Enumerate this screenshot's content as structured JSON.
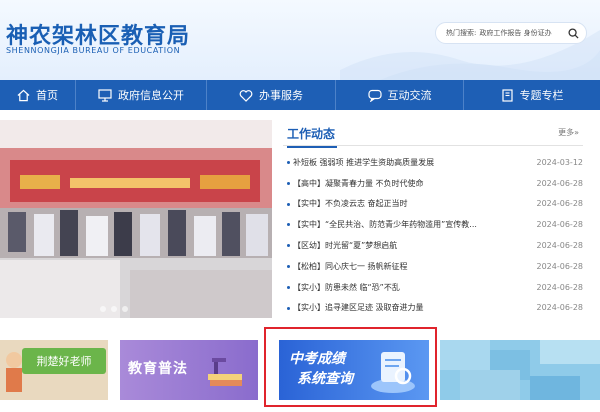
{
  "header": {
    "title_cn": "神农架林区教育局",
    "title_en": "SHENNONGJIA BUREAU OF EDUCATION",
    "search": {
      "label": "热门搜索:",
      "hot_terms": "政府工作报告 身份证办"
    }
  },
  "nav": {
    "items": [
      {
        "label": "首页",
        "icon": "home-icon"
      },
      {
        "label": "政府信息公开",
        "icon": "monitor-icon"
      },
      {
        "label": "办事服务",
        "icon": "heart-icon"
      },
      {
        "label": "互动交流",
        "icon": "chat-icon"
      },
      {
        "label": "专题专栏",
        "icon": "book-icon"
      }
    ]
  },
  "news": {
    "title": "工作动态",
    "more": "更多»",
    "items": [
      {
        "title": "补短板 强弱项 推进学生资助高质量发展",
        "date": "2024-03-12"
      },
      {
        "title": "【高中】凝聚青春力量 不负时代使命",
        "date": "2024-06-28"
      },
      {
        "title": "【实中】不负凌云志 奋起正当时",
        "date": "2024-06-28"
      },
      {
        "title": "【实中】“全民共治、防范青少年药物滥用”宣传教...",
        "date": "2024-06-28"
      },
      {
        "title": "【区幼】时光留“夏”梦想启航",
        "date": "2024-06-28"
      },
      {
        "title": "【松柏】同心庆七一 扬帆新征程",
        "date": "2024-06-28"
      },
      {
        "title": "【实小】防患未然 临“恐”不乱",
        "date": "2024-06-28"
      },
      {
        "title": "【实小】追寻建区足迹 汲取奋进力量",
        "date": "2024-06-28"
      }
    ]
  },
  "tiles": {
    "tile1": "荆楚好老师",
    "tile2": "教育普法",
    "tile3_line1": "中考成绩",
    "tile3_line2": "系统查询"
  },
  "colors": {
    "brand_blue": "#1e5fb5",
    "highlight_red": "#e0242c"
  }
}
